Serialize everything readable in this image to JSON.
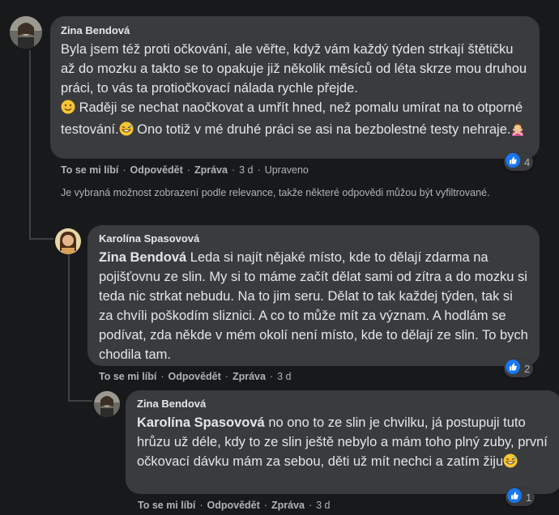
{
  "colors": {
    "background": "#18191a",
    "bubble": "#3a3b3c",
    "text": "#e4e6eb",
    "secondary": "#b0b3b8",
    "like_blue": "#1877f2"
  },
  "actions": {
    "like": "To se mi líbí",
    "reply": "Odpovědět",
    "share": "Zpráva",
    "separator": "·"
  },
  "comments": [
    {
      "author": "Zina Bendová",
      "body": "Byla jsem též proti očkování, ale věřte, když vám každý týden strkají štětičku až do mozku a takto se to opakuje již několik měsíců od léta skrze mou druhou práci, to vás ta protiočkovací nálada rychle přejde.",
      "body_2": " Raději se nechat naočkovat a umřít hned, než pomalu umírat na to otporné testování.",
      "body_3": " Ono totiž v mé druhé práci se asi na bezbolestné testy nehraje.",
      "emojis": [
        "smiling-face-icon",
        "grinning-sweat-icon",
        "person-gesturing-no-icon"
      ],
      "time": "3 d",
      "edited": "Upraveno",
      "reaction_count": "4"
    },
    {
      "author": "Karolína Spasovová",
      "mention": "Zina Bendová",
      "body": " Leda si najít nějaké místo, kde to dělají zdarma na pojišťovnu ze slin. My si to máme začít dělat sami od zítra a do mozku si teda nic strkat nebudu. Na to jim seru. Dělat to tak každej týden, tak si za chvíli poškodím sliznici. A co to může mít za význam. A hodlám se podívat, zda někde v mém okolí není místo, kde to dělají ze slin. To bych chodila tam.",
      "time": "3 d",
      "reaction_count": "2"
    },
    {
      "author": "Zina Bendová",
      "mention": "Karolína Spasovová",
      "body": " no ono to ze slin je chvilku, já postupuji tuto hrůzu už déle, kdy to ze slin ještě nebylo a mám toho plný zuby, první očkovací dávku mám za sebou, děti už mít nechci a zatím žiju",
      "emojis": [
        "grinning-sweat-icon"
      ],
      "time": "3 d",
      "reaction_count": "1"
    }
  ],
  "relevance_notice": "Je vybraná možnost zobrazení podle relevance, takže některé odpovědi můžou být vyfiltrované."
}
